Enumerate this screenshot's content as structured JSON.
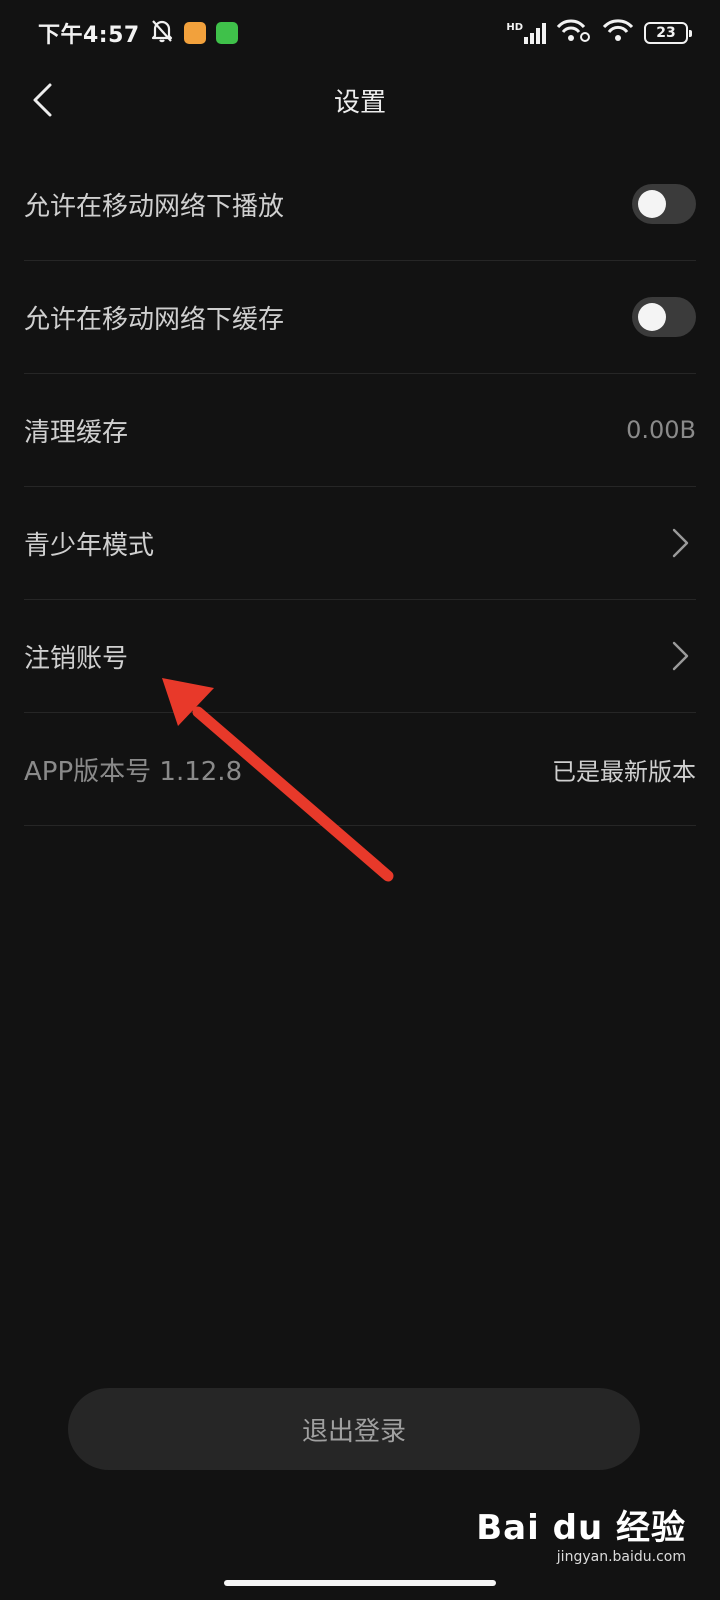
{
  "status_bar": {
    "time": "下午4:57",
    "signal_label": "HD",
    "battery_level": "23"
  },
  "header": {
    "title": "设置"
  },
  "settings": {
    "items": [
      {
        "label": "允许在移动网络下播放",
        "control": "toggle",
        "on": false
      },
      {
        "label": "允许在移动网络下缓存",
        "control": "toggle",
        "on": false
      },
      {
        "label": "清理缓存",
        "value": "0.00B"
      },
      {
        "label": "青少年模式",
        "control": "chevron-right-icon"
      },
      {
        "label": "注销账号",
        "control": "chevron-right-icon"
      },
      {
        "label": "APP版本号 1.12.8",
        "value": "已是最新版本"
      }
    ]
  },
  "logout": {
    "label": "退出登录"
  },
  "watermark": {
    "logo": "Bai du 经验",
    "url": "jingyan.baidu.com"
  },
  "colors": {
    "background": "#121212",
    "annotation_arrow": "#e8392a"
  }
}
